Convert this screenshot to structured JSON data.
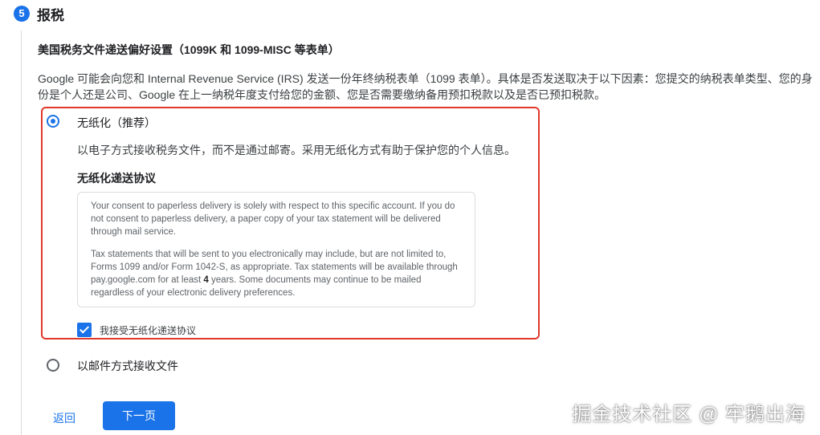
{
  "step": {
    "number": "5",
    "title": "报税"
  },
  "preferences": {
    "title": "美国税务文件递送偏好设置（1099K 和 1099-MISC 等表单）",
    "intro": "Google 可能会向您和 Internal Revenue Service (IRS) 发送一份年终纳税表单（1099 表单）。具体是否发送取决于以下因素：您提交的纳税表单类型、您的身份是个人还是公司、Google 在上一纳税年度支付给您的金额、您是否需要缴纳备用预扣税款以及是否已预扣税款。"
  },
  "paperless": {
    "label": "无纸化（推荐）",
    "selected": true,
    "description": "以电子方式接收税务文件，而不是通过邮寄。采用无纸化方式有助于保护您的个人信息。",
    "agreement_title": "无纸化递送协议",
    "agreement_p1": "Your consent to paperless delivery is solely with respect to this specific account. If you do not consent to paperless delivery, a paper copy of your tax statement will be delivered through mail service.",
    "agreement_p2_before": "Tax statements that will be sent to you electronically may include, but are not limited to, Forms 1099 and/or Form 1042-S, as appropriate. Tax statements will be available through pay.google.com for at least ",
    "agreement_p2_bold": "4",
    "agreement_p2_after": " years. Some documents may continue to be mailed regardless of your electronic delivery preferences.",
    "checkbox_label": "我接受无纸化递送协议",
    "checkbox_checked": true
  },
  "mail": {
    "label": "以邮件方式接收文件",
    "selected": false
  },
  "actions": {
    "back_label": "返回",
    "next_label": "下一页"
  },
  "watermark": "掘金技术社区 @ 牢鹅出海",
  "colors": {
    "accent": "#1a73e8",
    "highlight_border": "#e0392b"
  }
}
